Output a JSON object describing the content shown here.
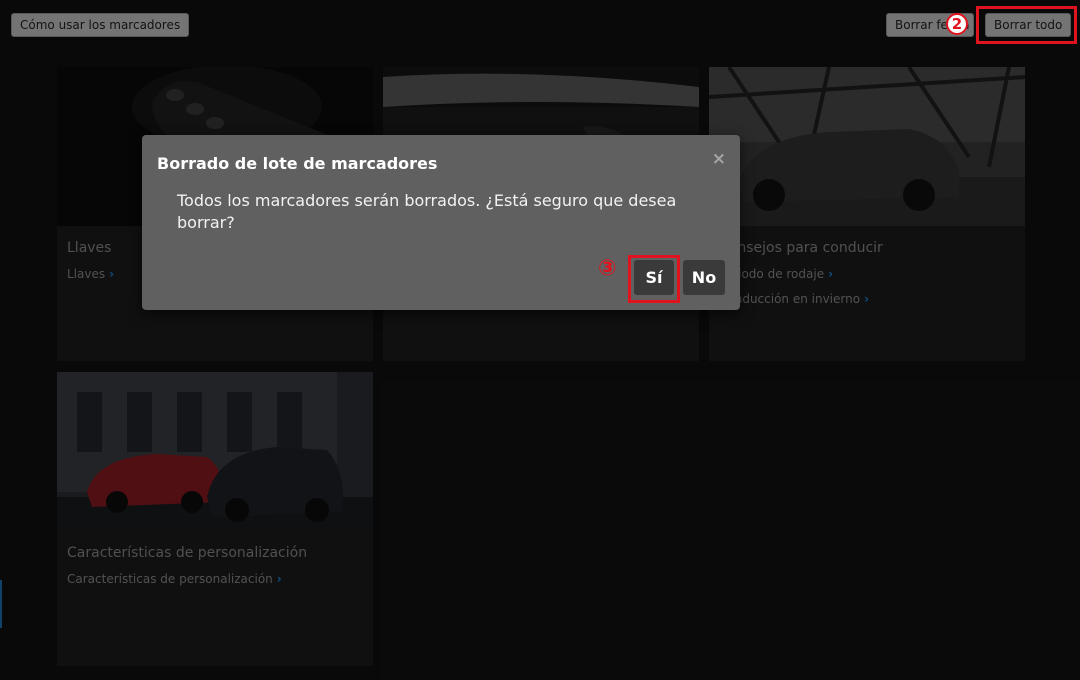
{
  "toolbar": {
    "help_label": "Cómo usar los marcadores",
    "delete_label": "Borrar fecha",
    "delete_all_label": "Borrar todo"
  },
  "cards": [
    {
      "title": "Llaves",
      "links": [
        "Llaves"
      ]
    },
    {
      "title": "",
      "links": []
    },
    {
      "title": "Consejos para conducir",
      "links": [
        "Periodo de rodaje",
        "Conducción en invierno"
      ]
    },
    {
      "title": "Características de personalización",
      "links": [
        "Características de personalización"
      ]
    }
  ],
  "dialog": {
    "title": "Borrado de lote de marcadores",
    "message": "Todos los marcadores serán borrados. ¿Está seguro que desea borrar?",
    "yes_label": "Sí",
    "no_label": "No",
    "close_glyph": "×"
  },
  "annotations": {
    "step_2": "2",
    "step_3": "③"
  },
  "colors": {
    "highlight": "#e0141e",
    "link_chevron": "#1e88e5"
  },
  "icons": {
    "chevron": "›",
    "close": "×"
  }
}
